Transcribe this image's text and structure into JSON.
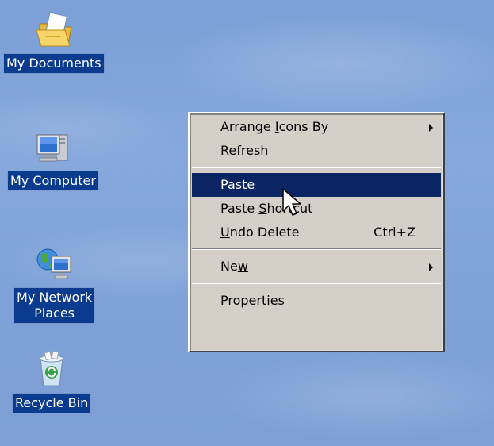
{
  "desktop": {
    "background_color": "#7fa2d8",
    "icons": [
      {
        "label": "My Documents",
        "icon": "folder-documents-icon"
      },
      {
        "label": "My Computer",
        "icon": "computer-icon"
      },
      {
        "label": "My Network\nPlaces",
        "icon": "network-places-icon"
      },
      {
        "label": "Recycle Bin",
        "icon": "recycle-bin-icon"
      }
    ]
  },
  "context_menu": {
    "highlight_color": "#0b2463",
    "items": [
      {
        "before": "Arrange ",
        "mnemonic": "I",
        "after": "cons By",
        "has_submenu": true
      },
      {
        "before": "R",
        "mnemonic": "e",
        "after": "fresh"
      },
      {
        "before": "",
        "mnemonic": "P",
        "after": "aste",
        "highlighted": true
      },
      {
        "before": "Paste ",
        "mnemonic": "S",
        "after": "hortcut"
      },
      {
        "before": "",
        "mnemonic": "U",
        "after": "ndo Delete",
        "shortcut": "Ctrl+Z"
      },
      {
        "before": "Ne",
        "mnemonic": "w",
        "after": "",
        "has_submenu": true
      },
      {
        "before": "P",
        "mnemonic": "r",
        "after": "operties"
      }
    ]
  },
  "cursor": {
    "icon": "arrow-cursor-icon"
  }
}
